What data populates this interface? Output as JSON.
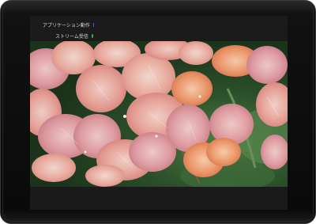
{
  "overlay": {
    "app_action_label": "アプリケーション動作",
    "app_action_color": "#2f6fd1",
    "stream_receive_label": "ストリーム受信",
    "stream_receive_color": "#2fb36b"
  },
  "video": {
    "subject_icon": "photo-bougainvillea"
  }
}
